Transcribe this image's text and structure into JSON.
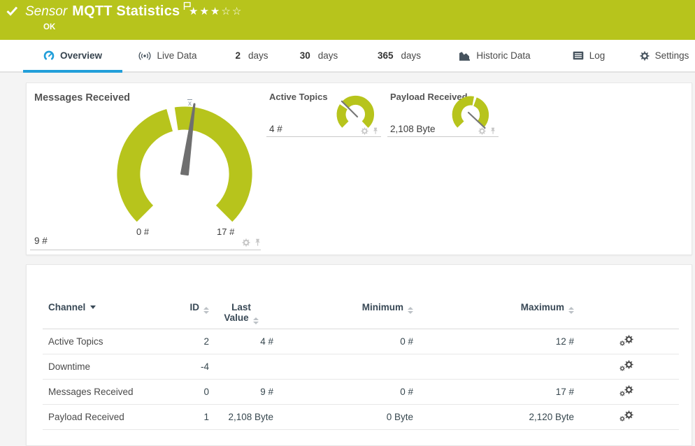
{
  "colors": {
    "banner_green": "#b7c41c",
    "accent_blue": "#219ed9",
    "gauge_green": "#b7c41c"
  },
  "header": {
    "kind": "Sensor",
    "title": "MQTT Statistics",
    "status": "OK",
    "rating": {
      "filled": 3,
      "total": 5
    }
  },
  "tabs": [
    {
      "icon": "gauge",
      "label": "Overview",
      "active": true
    },
    {
      "icon": "broadcast",
      "label": "Live Data"
    },
    {
      "num": "2",
      "label": "days"
    },
    {
      "num": "30",
      "label": "days"
    },
    {
      "num": "365",
      "label": "days"
    },
    {
      "icon": "chart",
      "label": "Historic Data"
    },
    {
      "icon": "log",
      "label": "Log"
    },
    {
      "icon": "gear",
      "label": "Settings"
    }
  ],
  "gauges": {
    "primary": {
      "title": "Messages Received",
      "value": "9 #",
      "scale_min": "0 #",
      "scale_max": "17 #",
      "avg_marker": "x"
    },
    "mini": [
      {
        "title": "Active Topics",
        "value": "4 #"
      },
      {
        "title": "Payload Received",
        "value": "2,108 Byte"
      }
    ]
  },
  "table": {
    "headers": {
      "channel": "Channel",
      "id": "ID",
      "last_line1": "Last",
      "last_line2": "Value",
      "minimum": "Minimum",
      "maximum": "Maximum"
    },
    "rows": [
      {
        "channel": "Active Topics",
        "id": "2",
        "last": "4 #",
        "min": "0 #",
        "max": "12 #"
      },
      {
        "channel": "Downtime",
        "id": "-4",
        "last": "",
        "min": "",
        "max": ""
      },
      {
        "channel": "Messages Received",
        "id": "0",
        "last": "9 #",
        "min": "0 #",
        "max": "17 #"
      },
      {
        "channel": "Payload Received",
        "id": "1",
        "last": "2,108 Byte",
        "min": "0 Byte",
        "max": "2,120 Byte"
      }
    ]
  }
}
